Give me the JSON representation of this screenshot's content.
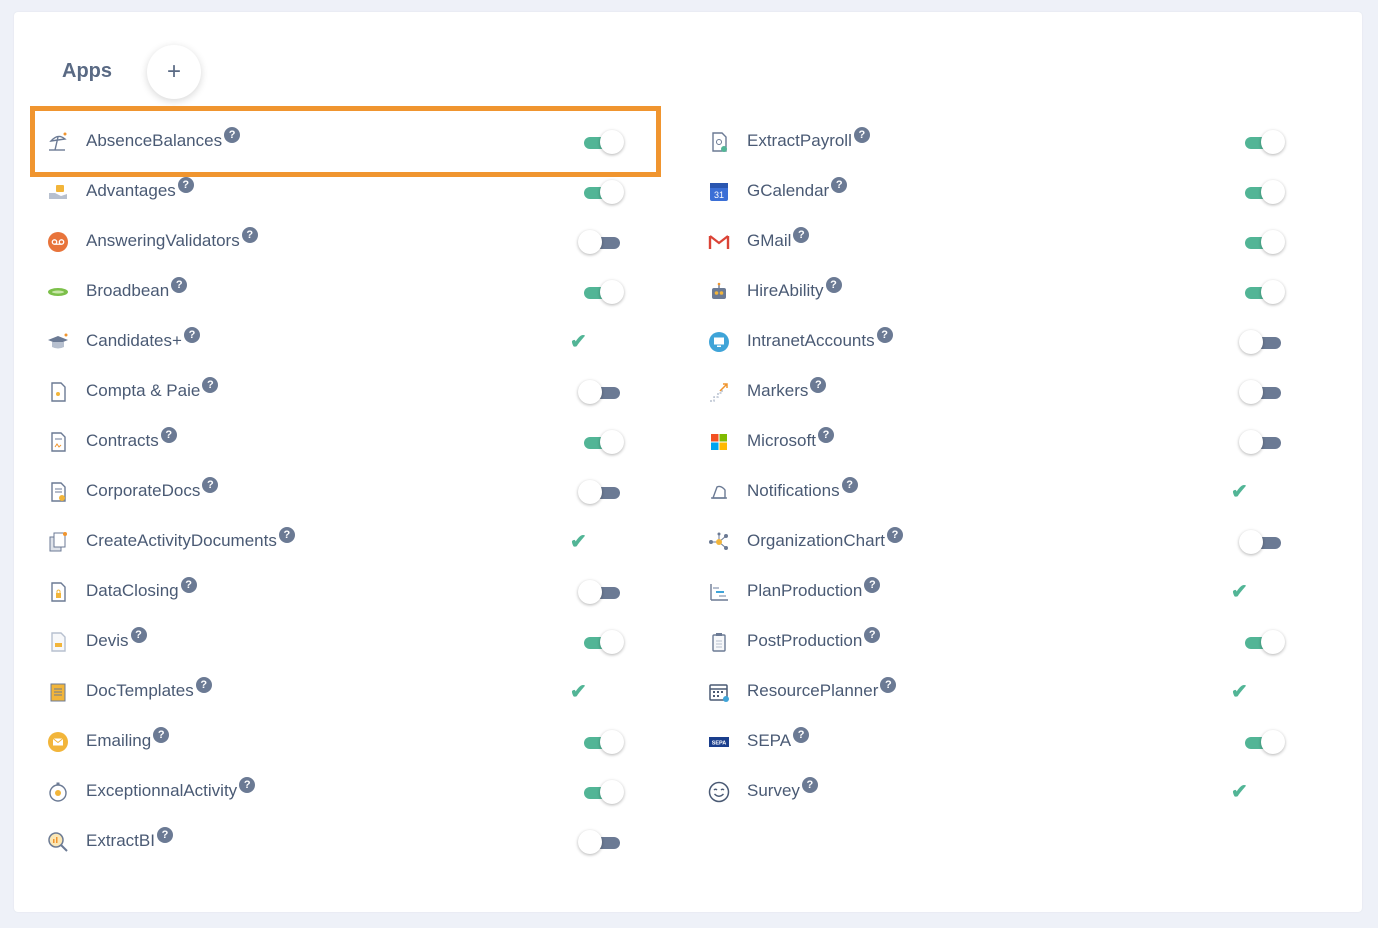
{
  "header": {
    "title": "Apps",
    "add_label": "+"
  },
  "colors": {
    "accent_on": "#52b596",
    "toggle_off": "#6b7a94",
    "highlight": "#f0952f"
  },
  "left_apps": [
    {
      "name": "AbsenceBalances",
      "icon": "beach-umbrella-icon",
      "state": "on"
    },
    {
      "name": "Advantages",
      "icon": "gift-hand-icon",
      "state": "on"
    },
    {
      "name": "AnsweringValidators",
      "icon": "voicemail-icon",
      "state": "off"
    },
    {
      "name": "Broadbean",
      "icon": "broadbean-logo-icon",
      "state": "on"
    },
    {
      "name": "Candidates+",
      "icon": "graduation-cap-icon",
      "state": "check"
    },
    {
      "name": "Compta & Paie",
      "icon": "document-payroll-icon",
      "state": "off"
    },
    {
      "name": "Contracts",
      "icon": "document-contract-icon",
      "state": "on"
    },
    {
      "name": "CorporateDocs",
      "icon": "document-corporate-icon",
      "state": "off"
    },
    {
      "name": "CreateActivityDocuments",
      "icon": "documents-stack-icon",
      "state": "check"
    },
    {
      "name": "DataClosing",
      "icon": "document-lock-icon",
      "state": "off"
    },
    {
      "name": "Devis",
      "icon": "document-quote-icon",
      "state": "on"
    },
    {
      "name": "DocTemplates",
      "icon": "document-template-icon",
      "state": "check"
    },
    {
      "name": "Emailing",
      "icon": "email-icon",
      "state": "on"
    },
    {
      "name": "ExceptionnalActivity",
      "icon": "stopwatch-icon",
      "state": "on"
    },
    {
      "name": "ExtractBI",
      "icon": "magnifier-chart-icon",
      "state": "off"
    }
  ],
  "right_apps": [
    {
      "name": "ExtractPayroll",
      "icon": "document-export-icon",
      "state": "on"
    },
    {
      "name": "GCalendar",
      "icon": "google-calendar-icon",
      "state": "on"
    },
    {
      "name": "GMail",
      "icon": "gmail-icon",
      "state": "on"
    },
    {
      "name": "HireAbility",
      "icon": "robot-icon",
      "state": "on"
    },
    {
      "name": "IntranetAccounts",
      "icon": "intranet-monitor-icon",
      "state": "off"
    },
    {
      "name": "Markers",
      "icon": "stairs-arrow-icon",
      "state": "off"
    },
    {
      "name": "Microsoft",
      "icon": "microsoft-logo-icon",
      "state": "off"
    },
    {
      "name": "Notifications",
      "icon": "bell-icon",
      "state": "check"
    },
    {
      "name": "OrganizationChart",
      "icon": "network-nodes-icon",
      "state": "off"
    },
    {
      "name": "PlanProduction",
      "icon": "gantt-chart-icon",
      "state": "check"
    },
    {
      "name": "PostProduction",
      "icon": "clipboard-icon",
      "state": "on"
    },
    {
      "name": "ResourcePlanner",
      "icon": "calendar-grid-icon",
      "state": "check"
    },
    {
      "name": "SEPA",
      "icon": "sepa-logo-icon",
      "state": "on"
    },
    {
      "name": "Survey",
      "icon": "smiley-icon",
      "state": "check"
    }
  ],
  "help_glyph": "?",
  "check_glyph": "✔",
  "sepa_text": "SEPA",
  "gcal_text": "31"
}
